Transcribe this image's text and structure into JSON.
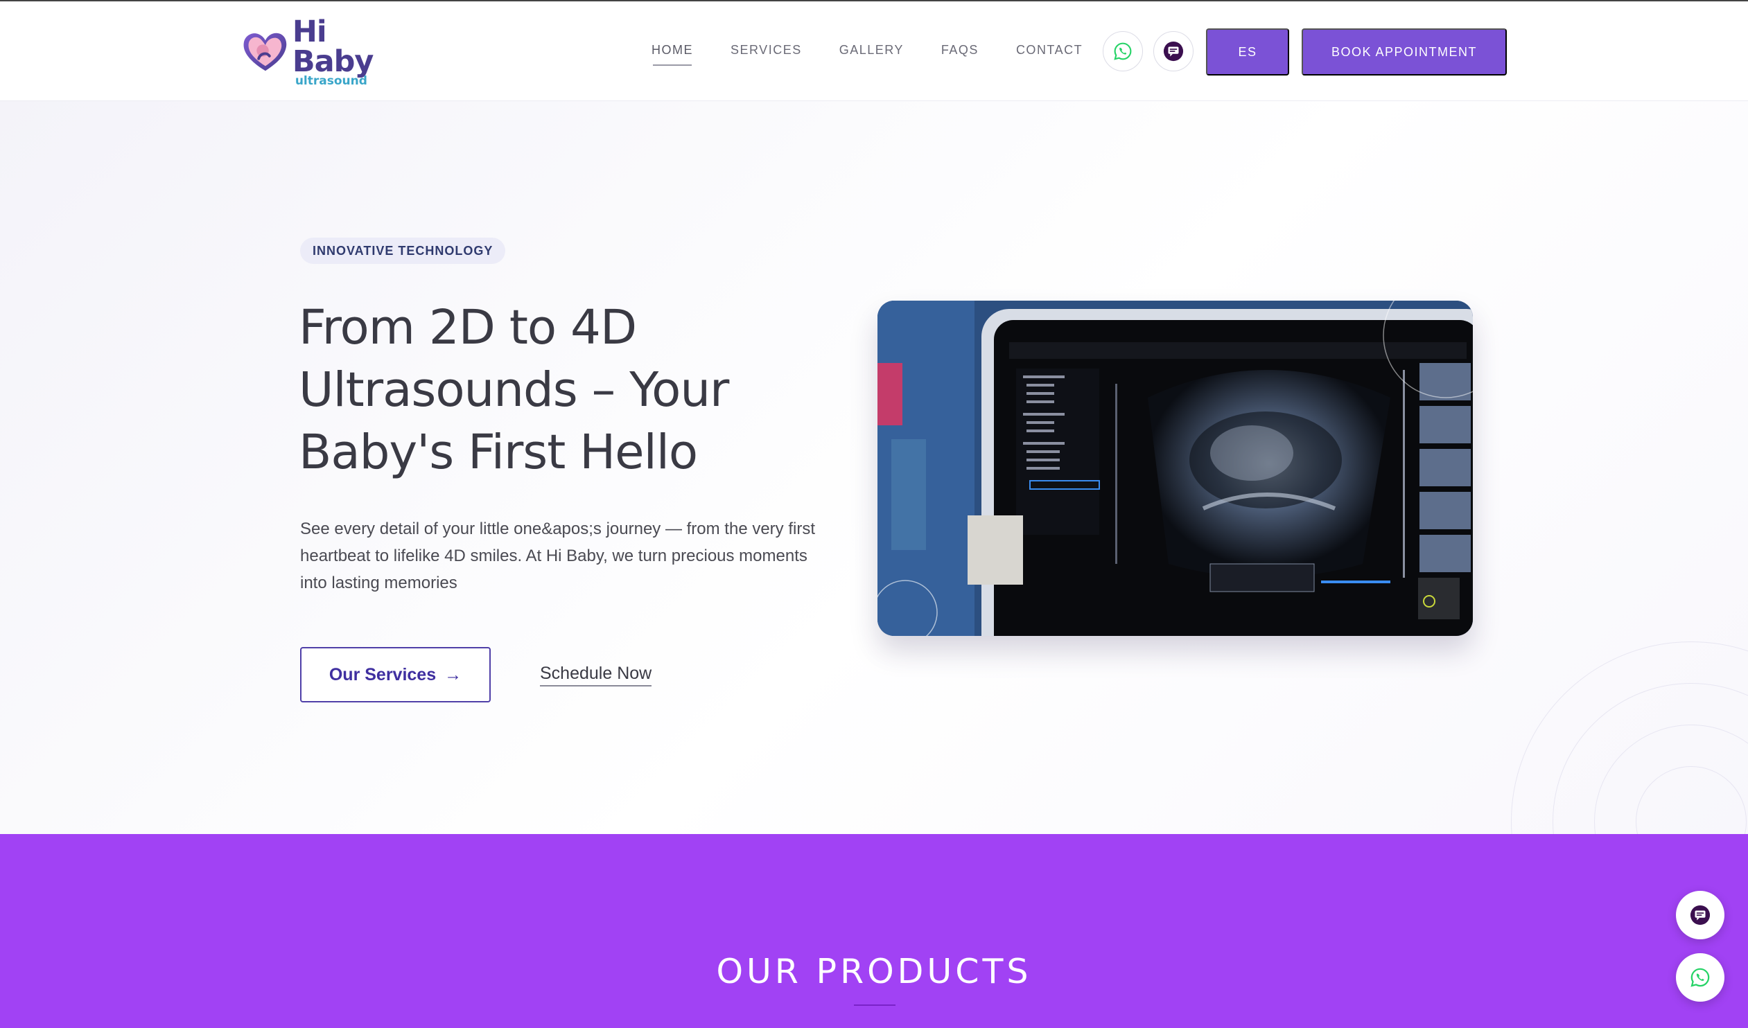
{
  "brand": {
    "name": "Hi Baby",
    "tagline": "ultrasound"
  },
  "nav": {
    "items": [
      {
        "label": "HOME",
        "active": true
      },
      {
        "label": "SERVICES",
        "active": false
      },
      {
        "label": "GALLERY",
        "active": false
      },
      {
        "label": "FAQS",
        "active": false
      },
      {
        "label": "CONTACT",
        "active": false
      }
    ],
    "language_label": "ES",
    "book_label": "BOOK APPOINTMENT"
  },
  "hero": {
    "badge": "INNOVATIVE TECHNOLOGY",
    "title_lines": [
      "From 2D to 4D",
      "Ultrasounds – Your",
      "Baby's First Hello"
    ],
    "description": "See every detail of your little one&apos;s journey — from the very first heartbeat to lifelike 4D smiles. At Hi Baby, we turn precious moments into lasting memories",
    "primary_button": "Our Services",
    "primary_arrow": "→",
    "secondary_link": "Schedule Now"
  },
  "products": {
    "title": "OUR PRODUCTS"
  },
  "icons": {
    "whatsapp": "whatsapp-icon",
    "chat": "chat-icon"
  },
  "colors": {
    "accent": "#7b52d6",
    "products_bg": "#a142f4",
    "whatsapp": "#25d366",
    "chat": "#3b0f4f",
    "brand_text": "#4a3d8f"
  }
}
